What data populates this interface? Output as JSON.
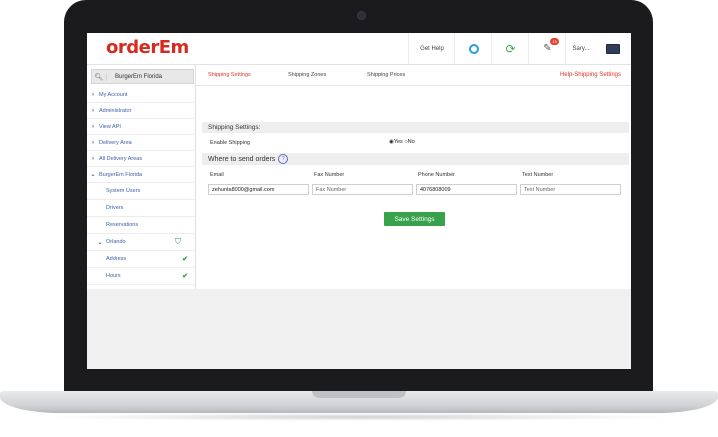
{
  "app": {
    "logo": "orderEm"
  },
  "topbar": {
    "get_help": "Get Help",
    "user": "Sary...",
    "badge": "19",
    "icons": [
      "speedometer-icon",
      "refresh-icon",
      "notification-icon",
      "monitor-icon"
    ]
  },
  "sidebar": {
    "search_value": "BurgerEm Florida",
    "items": [
      {
        "label": "My Account"
      },
      {
        "label": "Administrator"
      },
      {
        "label": "View API"
      },
      {
        "label": "Delivery Area"
      },
      {
        "label": "All Delivery Areas"
      },
      {
        "label": "BurgerEm Florida"
      },
      {
        "label": "System Users"
      },
      {
        "label": "Drivers"
      },
      {
        "label": "Reservations"
      },
      {
        "label": "Orlando"
      },
      {
        "label": "Address"
      },
      {
        "label": "Hours"
      }
    ]
  },
  "tabs": [
    {
      "label": "Shipping Settings",
      "active": true
    },
    {
      "label": "Shipping Zones",
      "active": false
    },
    {
      "label": "Shipping Prices",
      "active": false
    }
  ],
  "help_link": "Help-Shipping Settings",
  "section": {
    "title": "Shipping Settings:",
    "enable_label": "Enable Shipping",
    "yes": "Yes",
    "no": "No",
    "orders_title": "Where to send orders"
  },
  "fields": [
    {
      "label": "Email",
      "value": "zehunta8000@gmail.com"
    },
    {
      "label": "Fax Number",
      "value": "Fax Number"
    },
    {
      "label": "Phone Number",
      "value": "4076808009"
    },
    {
      "label": "Text Number",
      "value": "Text Number"
    }
  ],
  "save_button": "Save Settings",
  "colors": {
    "brand": "#d62b1f",
    "accent": "#d83a2a",
    "link": "#3a62a7",
    "success": "#37a24b"
  }
}
